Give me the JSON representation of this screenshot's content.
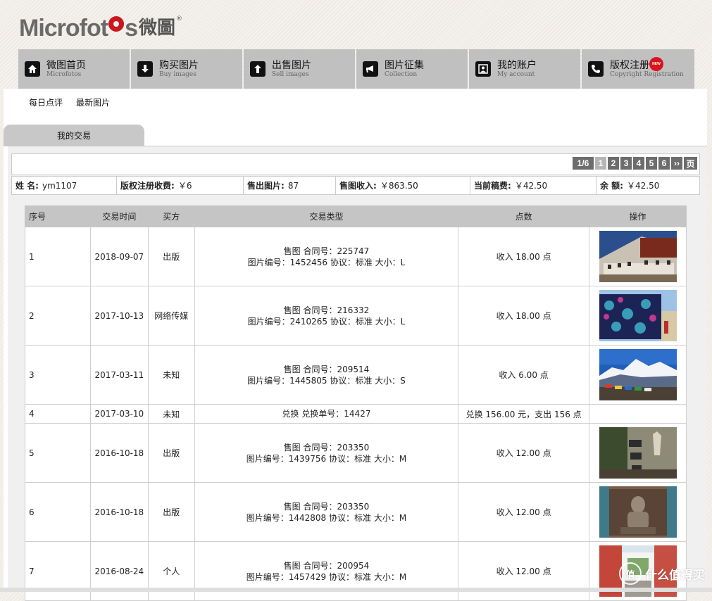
{
  "logo": {
    "text_before": "Microfot",
    "text_after": "s",
    "cn": "微圖",
    "reg": "®"
  },
  "nav": [
    {
      "cn": "微图首页",
      "en": "Microfotos",
      "icon": "home-icon"
    },
    {
      "cn": "购买图片",
      "en": "Buy images",
      "icon": "download-icon"
    },
    {
      "cn": "出售图片",
      "en": "Sell images",
      "icon": "upload-icon"
    },
    {
      "cn": "图片征集",
      "en": "Collection",
      "icon": "megaphone-icon"
    },
    {
      "cn": "我的账户",
      "en": "My account",
      "icon": "account-icon"
    },
    {
      "cn": "版权注册",
      "en": "Copyright Registration",
      "icon": "phone-icon",
      "badge": "NEW"
    }
  ],
  "subnav": [
    "每日点评",
    "最新图片"
  ],
  "tab": "我的交易",
  "pager": {
    "current": "1/6",
    "pages": [
      "1",
      "2",
      "3",
      "4",
      "5",
      "6"
    ],
    "next": "››",
    "page_label": "页"
  },
  "info": {
    "name_label": "姓 名:",
    "name_value": "ym1107",
    "fee_label": "版权注册收费:",
    "fee_value": "￥6",
    "sold_label": "售出图片:",
    "sold_value": "87",
    "income_label": "售图收入:",
    "income_value": "￥863.50",
    "payout_label": "当前稿费:",
    "payout_value": "￥42.50",
    "balance_label": "余 额:",
    "balance_value": "￥42.50"
  },
  "table": {
    "headers": [
      "序号",
      "交易时间",
      "买方",
      "交易类型",
      "点数",
      "操作"
    ],
    "rows": [
      {
        "no": "1",
        "date": "2018-09-07",
        "buyer": "出版",
        "type_line1": "售图 合同号：225747",
        "type_line2": "图片编号：1452456 协议：标准 大小：L",
        "points": "收入 18.00 点",
        "thumb": "building"
      },
      {
        "no": "2",
        "date": "2017-10-13",
        "buyer": "网络传媒",
        "type_line1": "售图 合同号：216332",
        "type_line2": "图片编号：2410265 协议：标准 大小：L",
        "points": "收入 18.00 点",
        "thumb": "fabric"
      },
      {
        "no": "3",
        "date": "2017-03-11",
        "buyer": "未知",
        "type_line1": "售图 合同号：209514",
        "type_line2": "图片编号：1445805 协议：标准 大小：S",
        "points": "收入 6.00 点",
        "thumb": "mountain"
      },
      {
        "no": "4",
        "date": "2017-03-10",
        "buyer": "未知",
        "type_line1": "兑换 兑换单号：14427",
        "type_line2": "",
        "points": "兑换 156.00 元，支出 156 点",
        "thumb": ""
      },
      {
        "no": "5",
        "date": "2016-10-18",
        "buyer": "出版",
        "type_line1": "售图 合同号：203350",
        "type_line2": "图片编号：1439756 协议：标准 大小：M",
        "points": "收入 12.00 点",
        "thumb": "cliff"
      },
      {
        "no": "6",
        "date": "2016-10-18",
        "buyer": "出版",
        "type_line1": "售图 合同号：203350",
        "type_line2": "图片编号：1442808 协议：标准 大小：M",
        "points": "收入 12.00 点",
        "thumb": "statue"
      },
      {
        "no": "7",
        "date": "2016-08-24",
        "buyer": "个人",
        "type_line1": "售图 合同号：200954",
        "type_line2": "图片编号：1457429 协议：标准 大小：M",
        "points": "收入 12.00 点",
        "thumb": "street"
      }
    ]
  },
  "watermark": {
    "glyph": "值",
    "text": "什么值得买"
  }
}
